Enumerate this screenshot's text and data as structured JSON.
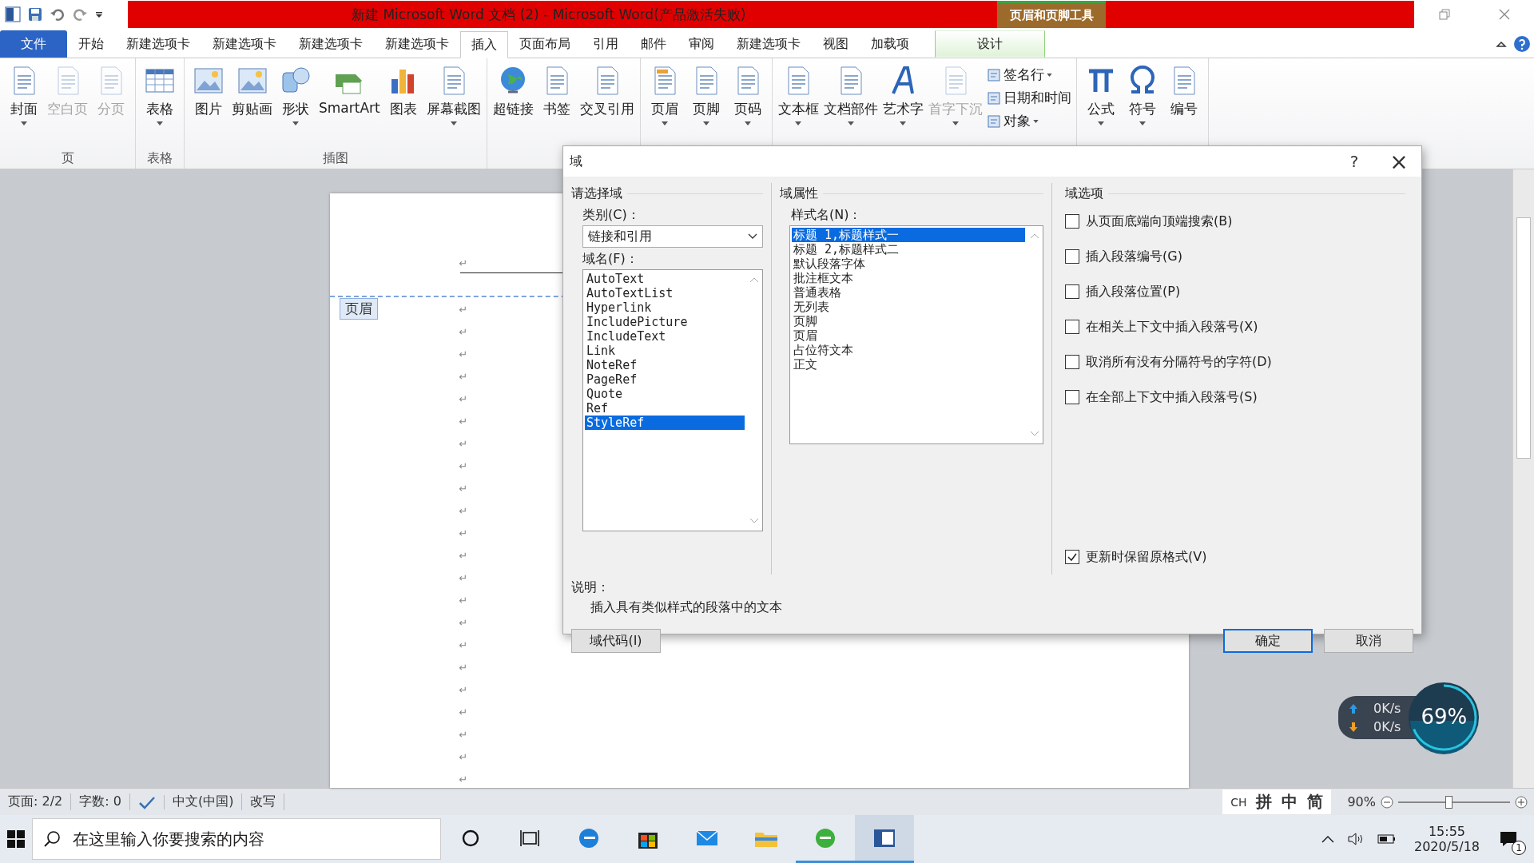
{
  "window": {
    "title": "新建 Microsoft Word 文档 (2) - Microsoft Word(产品激活失败)",
    "context_tool": "页眉和页脚工具"
  },
  "tabs": [
    {
      "label": "文件",
      "kind": "file",
      "selected": false
    },
    {
      "label": "开始",
      "kind": "plain",
      "selected": false
    },
    {
      "label": "新建选项卡",
      "kind": "plain",
      "selected": false
    },
    {
      "label": "新建选项卡",
      "kind": "plain",
      "selected": false
    },
    {
      "label": "新建选项卡",
      "kind": "plain",
      "selected": false
    },
    {
      "label": "新建选项卡",
      "kind": "plain",
      "selected": false
    },
    {
      "label": "插入",
      "kind": "plain",
      "selected": true
    },
    {
      "label": "页面布局",
      "kind": "plain",
      "selected": false
    },
    {
      "label": "引用",
      "kind": "plain",
      "selected": false
    },
    {
      "label": "邮件",
      "kind": "plain",
      "selected": false
    },
    {
      "label": "审阅",
      "kind": "plain",
      "selected": false
    },
    {
      "label": "新建选项卡",
      "kind": "plain",
      "selected": false
    },
    {
      "label": "视图",
      "kind": "plain",
      "selected": false
    },
    {
      "label": "加载项",
      "kind": "plain",
      "selected": false
    },
    {
      "label": "设计",
      "kind": "context",
      "selected": false
    }
  ],
  "ribbon": [
    {
      "label": "页",
      "buttons": [
        {
          "label": "封面",
          "dropdown": true,
          "disabled": false
        },
        {
          "label": "空白页",
          "dropdown": false,
          "disabled": true
        },
        {
          "label": "分页",
          "dropdown": false,
          "disabled": true
        }
      ]
    },
    {
      "label": "表格",
      "buttons": [
        {
          "label": "表格",
          "dropdown": true,
          "disabled": false
        }
      ]
    },
    {
      "label": "插图",
      "buttons": [
        {
          "label": "图片",
          "dropdown": false,
          "disabled": false
        },
        {
          "label": "剪贴画",
          "dropdown": false,
          "disabled": false
        },
        {
          "label": "形状",
          "dropdown": true,
          "disabled": false
        },
        {
          "label": "SmartArt",
          "dropdown": false,
          "disabled": false
        },
        {
          "label": "图表",
          "dropdown": false,
          "disabled": false
        },
        {
          "label": "屏幕截图",
          "dropdown": true,
          "disabled": false
        }
      ]
    },
    {
      "buttons": [
        {
          "label": "超链接",
          "dropdown": false,
          "disabled": false
        },
        {
          "label": "书签",
          "dropdown": false,
          "disabled": false
        },
        {
          "label": "交叉引用",
          "dropdown": false,
          "disabled": false
        }
      ]
    },
    {
      "buttons": [
        {
          "label": "页眉",
          "dropdown": true,
          "disabled": false
        },
        {
          "label": "页脚",
          "dropdown": true,
          "disabled": false
        },
        {
          "label": "页码",
          "dropdown": true,
          "disabled": false
        }
      ]
    },
    {
      "buttons": [
        {
          "label": "文本框",
          "dropdown": true,
          "disabled": false
        },
        {
          "label": "文档部件",
          "dropdown": true,
          "disabled": false
        },
        {
          "label": "艺术字",
          "dropdown": true,
          "disabled": false
        },
        {
          "label": "首字下沉",
          "dropdown": true,
          "disabled": true
        }
      ],
      "small_buttons": [
        {
          "label": "签名行",
          "dropdown": true
        },
        {
          "label": "日期和时间",
          "dropdown": false
        },
        {
          "label": "对象",
          "dropdown": true
        }
      ]
    },
    {
      "buttons": [
        {
          "label": "公式",
          "dropdown": true,
          "disabled": false
        },
        {
          "label": "符号",
          "dropdown": true,
          "disabled": false
        },
        {
          "label": "编号",
          "dropdown": false,
          "disabled": false
        }
      ]
    }
  ],
  "document": {
    "header_tag": "页眉",
    "header_mark": "↵",
    "paragraph_marks": [
      "↵",
      "↵",
      "↵",
      "↵",
      "↵",
      "↵",
      "↵",
      "↵",
      "↵",
      "↵",
      "↵",
      "↵",
      "↵",
      "↵",
      "↵",
      "↵",
      "↵",
      "↵",
      "↵",
      "↵",
      "↵",
      "↵"
    ]
  },
  "dialog": {
    "title": "域",
    "help": "?",
    "close": "×",
    "choose": {
      "heading": "请选择域",
      "category_label": "类别(C)：",
      "category": "链接和引用",
      "names_label": "域名(F)：",
      "names": [
        {
          "label": "AutoText",
          "selected": false
        },
        {
          "label": "AutoTextList",
          "selected": false
        },
        {
          "label": "Hyperlink",
          "selected": false
        },
        {
          "label": "IncludePicture",
          "selected": false
        },
        {
          "label": "IncludeText",
          "selected": false
        },
        {
          "label": "Link",
          "selected": false
        },
        {
          "label": "NoteRef",
          "selected": false
        },
        {
          "label": "PageRef",
          "selected": false
        },
        {
          "label": "Quote",
          "selected": false
        },
        {
          "label": "Ref",
          "selected": false
        },
        {
          "label": "StyleRef",
          "selected": true
        }
      ]
    },
    "properties": {
      "heading": "域属性",
      "styles_label": "样式名(N)：",
      "styles": [
        {
          "label": "标题 1,标题样式一",
          "selected": true
        },
        {
          "label": "标题 2,标题样式二",
          "selected": false
        },
        {
          "label": "默认段落字体",
          "selected": false
        },
        {
          "label": "批注框文本",
          "selected": false
        },
        {
          "label": "普通表格",
          "selected": false
        },
        {
          "label": "无列表",
          "selected": false
        },
        {
          "label": "页脚",
          "selected": false
        },
        {
          "label": "页眉",
          "selected": false
        },
        {
          "label": "占位符文本",
          "selected": false
        },
        {
          "label": "正文",
          "selected": false
        }
      ]
    },
    "options": {
      "heading": "域选项",
      "checks": [
        {
          "label": "从页面底端向顶端搜索(B)",
          "checked": false
        },
        {
          "label": "插入段落编号(G)",
          "checked": false
        },
        {
          "label": "插入段落位置(P)",
          "checked": false
        },
        {
          "label": "在相关上下文中插入段落号(X)",
          "checked": false
        },
        {
          "label": "取消所有没有分隔符号的字符(D)",
          "checked": false
        },
        {
          "label": "在全部上下文中插入段落号(S)",
          "checked": false
        }
      ],
      "preserve": {
        "label": "更新时保留原格式(V)",
        "checked": true
      }
    },
    "description_label": "说明：",
    "description": "插入具有类似样式的段落中的文本",
    "field_codes_button": "域代码(I)",
    "ok_button": "确定",
    "cancel_button": "取消"
  },
  "speed_widget": {
    "upload": "0K/s",
    "download": "0K/s",
    "usage": "69%",
    "level": 0.69
  },
  "status_bar": {
    "page": "页面: 2/2",
    "words": "字数: 0",
    "language": "中文(中国)",
    "mode": "改写",
    "ime": [
      "CH",
      "拼",
      "中",
      "简"
    ],
    "zoom": "90%",
    "level": 0.45
  },
  "taskbar": {
    "search_placeholder": "在这里输入你要搜索的内容",
    "apps": [
      {
        "running": false,
        "selected": false
      },
      {
        "running": false,
        "selected": false
      },
      {
        "running": false,
        "selected": false
      },
      {
        "running": false,
        "selected": false
      },
      {
        "running": false,
        "selected": false
      },
      {
        "running": false,
        "selected": false
      },
      {
        "running": true,
        "selected": false
      },
      {
        "running": true,
        "selected": true
      }
    ],
    "time": "15:55",
    "date": "2020/5/18",
    "notifications": "1"
  }
}
